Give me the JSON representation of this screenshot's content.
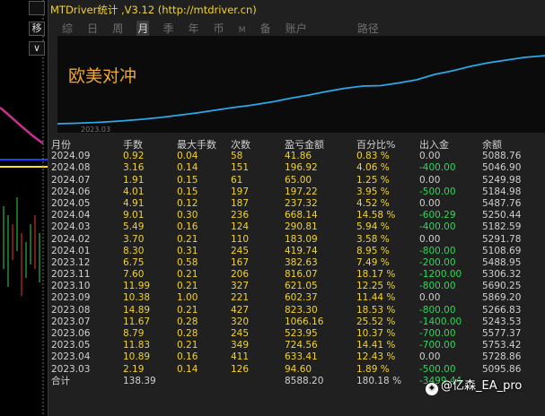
{
  "toolbar": {
    "btn_top": "",
    "btn_move": "移",
    "btn_collapse": "∨"
  },
  "window": {
    "title": "MTDriver统计 ,V3.12 (http://mtdriver.cn)"
  },
  "tabs": [
    {
      "label": "综",
      "active": false
    },
    {
      "label": "日",
      "active": false
    },
    {
      "label": "周",
      "active": false
    },
    {
      "label": "月",
      "active": true
    },
    {
      "label": "季",
      "active": false
    },
    {
      "label": "年",
      "active": false
    },
    {
      "label": "币",
      "active": false
    },
    {
      "label": "M",
      "active": false
    },
    {
      "label": "备",
      "active": false
    },
    {
      "label": "账户",
      "active": false
    },
    {
      "label": "路径",
      "active": false
    }
  ],
  "chart": {
    "strategy_name": "欧美对冲",
    "start_label": "2023.03",
    "line_color": "#29a9e8"
  },
  "table": {
    "headers": [
      "月份",
      "手数",
      "最大手数",
      "次数",
      "盈亏金额",
      "百分比%",
      "出入金",
      "余额"
    ],
    "rows": [
      [
        "2024.09",
        "0.92",
        "0.04",
        "58",
        "41.86",
        "0.83 %",
        "0.00",
        "5088.76"
      ],
      [
        "2024.08",
        "3.16",
        "0.14",
        "151",
        "196.92",
        "4.06 %",
        "-400.00",
        "5046.90"
      ],
      [
        "2024.07",
        "1.91",
        "0.15",
        "61",
        "65.00",
        "1.25 %",
        "0.00",
        "5249.98"
      ],
      [
        "2024.06",
        "4.01",
        "0.15",
        "197",
        "197.22",
        "3.95 %",
        "-500.00",
        "5184.98"
      ],
      [
        "2024.05",
        "4.91",
        "0.12",
        "187",
        "237.32",
        "4.52 %",
        "0.00",
        "5487.76"
      ],
      [
        "2024.04",
        "9.01",
        "0.30",
        "236",
        "668.14",
        "14.58 %",
        "-600.29",
        "5250.44"
      ],
      [
        "2024.03",
        "5.49",
        "0.16",
        "124",
        "290.81",
        "5.94 %",
        "-400.00",
        "5182.59"
      ],
      [
        "2024.02",
        "3.70",
        "0.21",
        "110",
        "183.09",
        "3.58 %",
        "0.00",
        "5291.78"
      ],
      [
        "2024.01",
        "8.30",
        "0.31",
        "245",
        "419.74",
        "8.95 %",
        "-800.00",
        "5108.69"
      ],
      [
        "2023.12",
        "6.75",
        "0.58",
        "167",
        "382.63",
        "7.49 %",
        "-200.00",
        "5488.95"
      ],
      [
        "2023.11",
        "7.60",
        "0.21",
        "206",
        "816.07",
        "18.17 %",
        "-1200.00",
        "5306.32"
      ],
      [
        "2023.10",
        "11.99",
        "0.21",
        "327",
        "621.05",
        "12.25 %",
        "-800.00",
        "5690.25"
      ],
      [
        "2023.09",
        "10.38",
        "1.00",
        "221",
        "602.37",
        "11.44 %",
        "0.00",
        "5869.20"
      ],
      [
        "2023.08",
        "14.89",
        "0.21",
        "427",
        "823.30",
        "18.53 %",
        "-800.00",
        "5266.83"
      ],
      [
        "2023.07",
        "11.67",
        "0.28",
        "320",
        "1066.16",
        "25.52 %",
        "-1400.00",
        "5243.53"
      ],
      [
        "2023.06",
        "8.79",
        "0.28",
        "245",
        "523.95",
        "10.37 %",
        "-700.00",
        "5577.37"
      ],
      [
        "2023.05",
        "11.83",
        "0.21",
        "349",
        "724.56",
        "14.41 %",
        "-700.00",
        "5753.42"
      ],
      [
        "2023.04",
        "10.89",
        "0.16",
        "411",
        "633.41",
        "12.43 %",
        "0.00",
        "5728.86"
      ],
      [
        "2023.03",
        "2.19",
        "0.14",
        "126",
        "94.60",
        "1.89 %",
        "-500.00",
        "5095.86"
      ]
    ],
    "total": [
      "合计",
      "138.39",
      "",
      "",
      "8588.20",
      "180.18 %",
      "-3499.44",
      ""
    ]
  },
  "watermark": {
    "text": "@亿森_EA_pro"
  }
}
